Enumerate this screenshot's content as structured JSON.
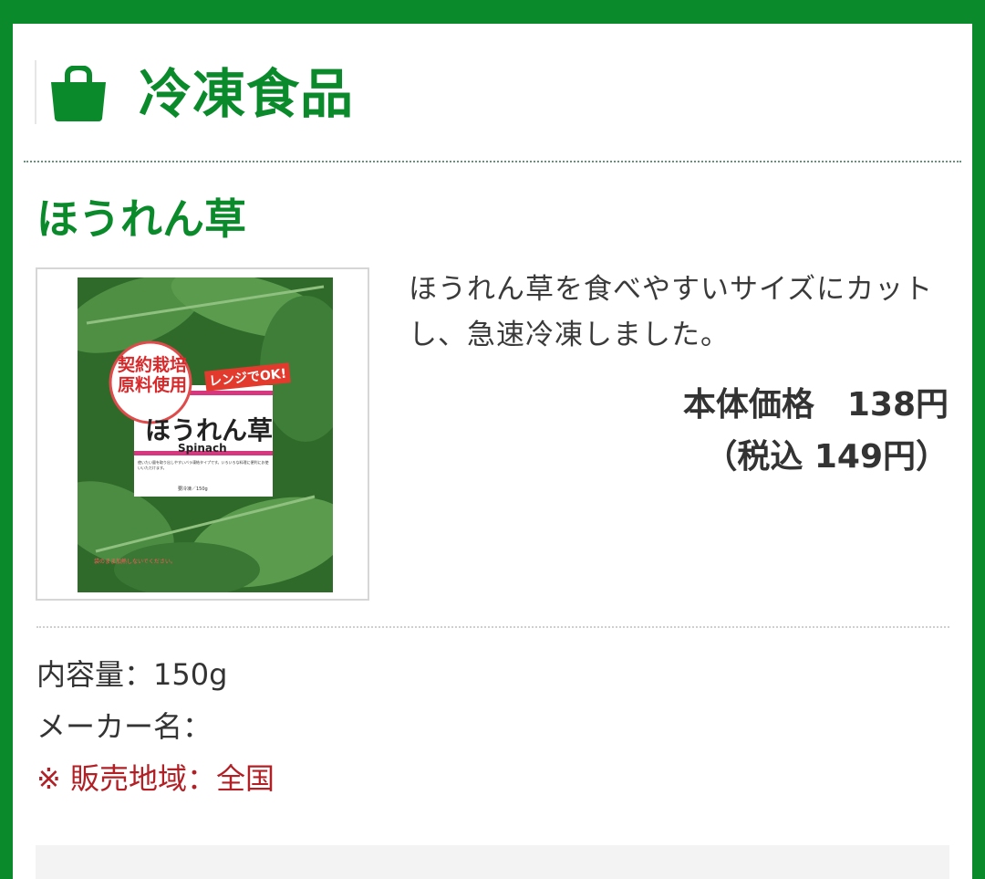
{
  "header": {
    "title": "冷凍食品",
    "icon": "shopping-bag-icon"
  },
  "product": {
    "name": "ほうれん草",
    "description": "ほうれん草を食べやすいサイズにカットし、急速冷凍しました。",
    "price_label": "本体価格　138円",
    "tax_price_label": "（税込 149円）",
    "image": {
      "badge_left": "契約栽培原料使用",
      "badge_right": "レンジでOK!",
      "package_title": "ほうれん草",
      "package_subtitle": "Spinach",
      "package_note": "使いたい量を取り出しやすいバラ凍結タイプです。いろいろな料理に便利にお使いいただけます。",
      "package_weight": "要冷凍／150g",
      "package_footer": "袋のまま加熱しないでください。"
    }
  },
  "info": {
    "content": "内容量：150g",
    "maker": "メーカー名：",
    "region": "※ 販売地域：全国"
  },
  "colors": {
    "brand_green": "#0b8a2c",
    "region_red": "#b22026"
  }
}
